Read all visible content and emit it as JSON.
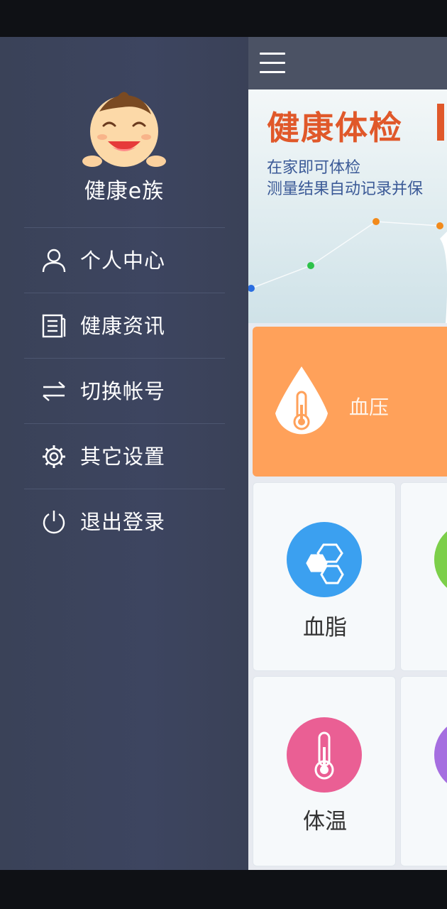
{
  "drawer": {
    "app_name": "健康e族",
    "menu": [
      {
        "label": "个人中心",
        "icon": "user-icon"
      },
      {
        "label": "健康资讯",
        "icon": "news-icon"
      },
      {
        "label": "切换帐号",
        "icon": "switch-icon"
      },
      {
        "label": "其它设置",
        "icon": "gear-icon"
      },
      {
        "label": "退出登录",
        "icon": "power-icon"
      }
    ]
  },
  "main": {
    "banner": {
      "title": "健康体检",
      "subtitle_1": "在家即可体检",
      "subtitle_2": "测量结果自动记录并保"
    },
    "tiles": {
      "blood_pressure": "血压",
      "blood_lipid": "血脂",
      "temperature": "体温"
    }
  },
  "colors": {
    "drawer_bg": "#3d4560",
    "toolbar_bg": "#4b5264",
    "banner_title": "#e0582a",
    "blood_pressure_tile": "#ffa15a",
    "blood_lipid_circle": "#3ba0f0",
    "temperature_circle": "#ea5f94",
    "green_circle": "#7ccf4a",
    "purple_circle": "#a56ee0"
  }
}
